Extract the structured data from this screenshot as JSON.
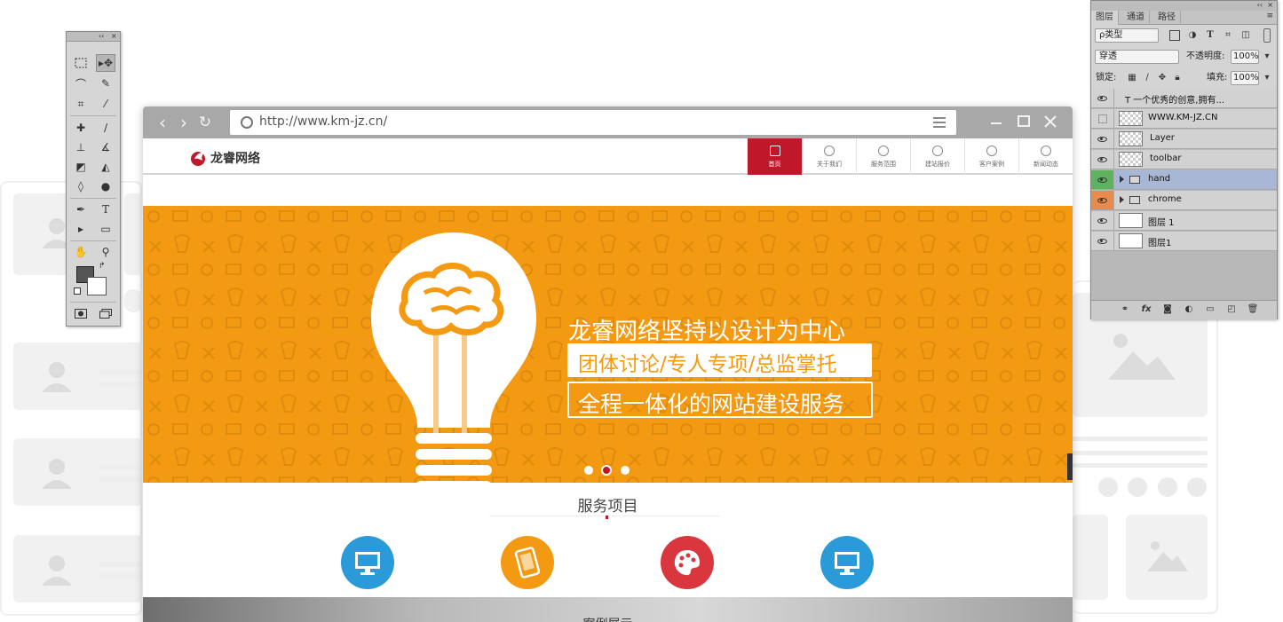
{
  "browser": {
    "url": "http://www.km-jz.cn/"
  },
  "site": {
    "logo_text": "龙睿网络",
    "nav": [
      {
        "label": "首页",
        "active": true
      },
      {
        "label": "关于我们"
      },
      {
        "label": "服务范围"
      },
      {
        "label": "建站报价"
      },
      {
        "label": "客户案例"
      },
      {
        "label": "新闻动态"
      }
    ],
    "banner": {
      "line1": "龙睿网络坚持以设计为中心",
      "line2": "团体讨论/专人专项/总监掌托",
      "line3": "全程一体化的网站建设服务",
      "slides": 3,
      "active_slide": 2
    },
    "services_title": "服务项目",
    "services": [
      {
        "icon": "monitor-icon",
        "color": "#2a9ad8"
      },
      {
        "icon": "mobile-icon",
        "color": "#f39a12"
      },
      {
        "icon": "palette-icon",
        "color": "#d9363e"
      },
      {
        "icon": "monitor-icon",
        "color": "#2a9ad8"
      }
    ],
    "next_section_title": "案例展示"
  },
  "tools_panel": {
    "header_collapse": "‹‹",
    "header_close": "×"
  },
  "layers_panel": {
    "tabs": [
      "图层",
      "通道",
      "路径"
    ],
    "filter_kind": "ρ类型",
    "blend_mode": "穿透",
    "opacity_label": "不透明度:",
    "opacity_value": "100%",
    "lock_label": "锁定:",
    "fill_label": "填充:",
    "fill_value": "100%",
    "layers": [
      {
        "name": "T 一个优秀的创意,拥有...",
        "type": "text"
      },
      {
        "name": "WWW.KM-JZ.CN",
        "type": "checker",
        "hidden": true
      },
      {
        "name": "Layer",
        "type": "smart"
      },
      {
        "name": "toolbar",
        "type": "smart"
      },
      {
        "name": "hand",
        "type": "group",
        "selected": true,
        "color": "#5fb35f"
      },
      {
        "name": "chrome",
        "type": "group",
        "color": "#e98c4b"
      },
      {
        "name": "图层 1",
        "type": "white"
      },
      {
        "name": "图层1",
        "type": "white"
      }
    ]
  },
  "colors": {
    "brand_red": "#c0182b",
    "banner_orange": "#f39a12",
    "blue": "#2a9ad8"
  }
}
